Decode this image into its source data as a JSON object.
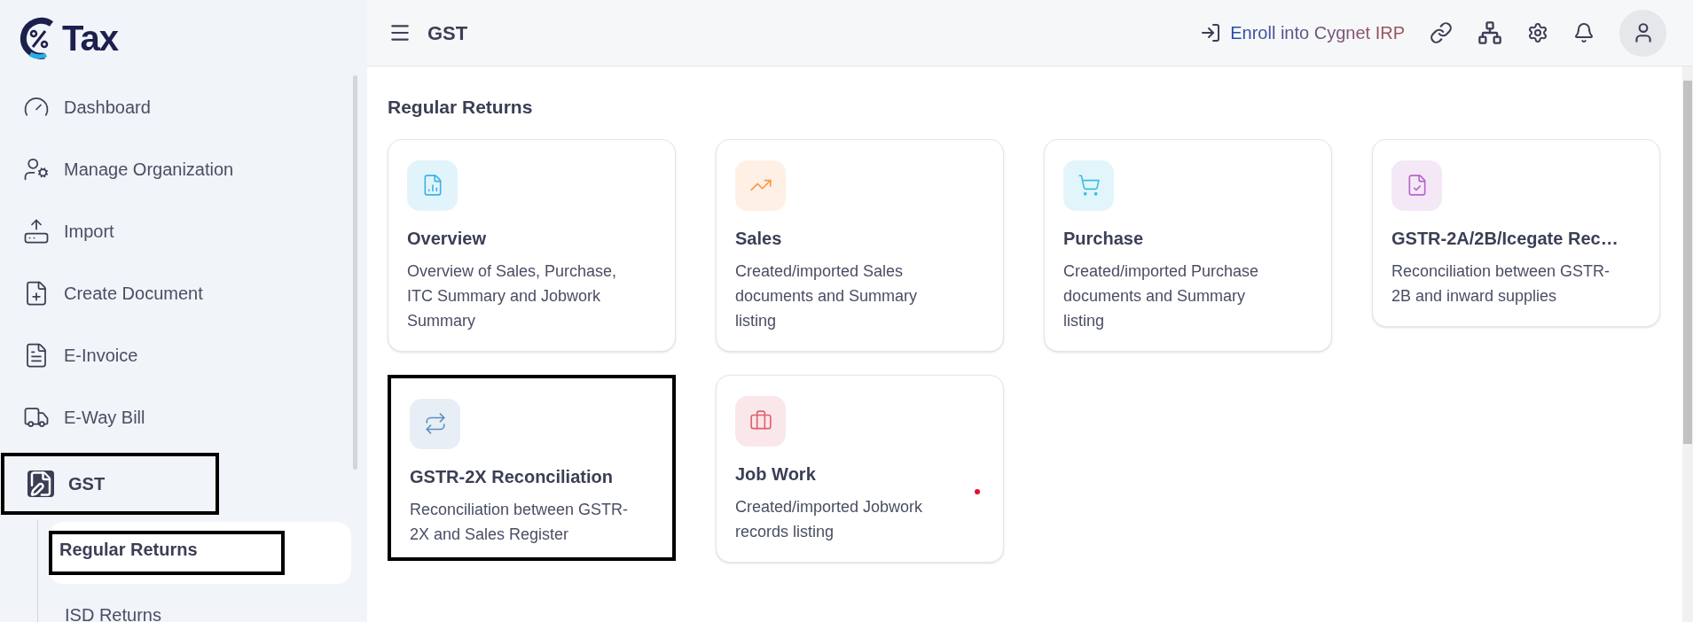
{
  "logo": {
    "text": "Tax"
  },
  "sidebar": {
    "items": [
      {
        "label": "Dashboard",
        "kind": "dashboard",
        "selected": false,
        "highlighted": false
      },
      {
        "label": "Manage Organization",
        "kind": "organization",
        "selected": false,
        "highlighted": false
      },
      {
        "label": "Import",
        "kind": "import",
        "selected": false,
        "highlighted": false
      },
      {
        "label": "Create Document",
        "kind": "create",
        "selected": false,
        "highlighted": false
      },
      {
        "label": "E-Invoice",
        "kind": "invoice",
        "selected": false,
        "highlighted": false
      },
      {
        "label": "E-Way Bill",
        "kind": "truck",
        "selected": false,
        "highlighted": false
      },
      {
        "label": "GST",
        "kind": "gst",
        "selected": true,
        "highlighted": true,
        "expanded": true,
        "children": [
          {
            "label": "Regular Returns",
            "selected": true,
            "highlighted": true
          },
          {
            "label": "ISD Returns",
            "selected": false,
            "highlighted": false
          }
        ]
      }
    ]
  },
  "header": {
    "title": "GST",
    "enroll_link": "Enroll into Cygnet IRP"
  },
  "section_title": "Regular Returns",
  "cards": [
    {
      "title": "Overview",
      "description": "Overview of Sales, Purchase, ITC Summary and Jobwork Summary",
      "kind": "report",
      "color": "#3bb2e6",
      "highlighted": false,
      "notification": false
    },
    {
      "title": "Sales",
      "description": "Created/imported Sales documents and Summary listing",
      "kind": "trend",
      "color": "#f59a4a",
      "highlighted": false,
      "notification": false
    },
    {
      "title": "Purchase",
      "description": "Created/imported Purchase documents and Summary listing",
      "kind": "cart",
      "color": "#3cbfe0",
      "highlighted": false,
      "notification": false
    },
    {
      "title": "GSTR-2A/2B/Icegate Rec…",
      "description": "Reconciliation between GSTR-2B and inward supplies",
      "kind": "check",
      "color": "#b865c9",
      "highlighted": false,
      "notification": false
    },
    {
      "title": "GSTR-2X Reconciliation",
      "description": "Reconciliation between GSTR-2X and Sales Register",
      "kind": "repeat",
      "color": "#5b8fc0",
      "highlighted": true,
      "notification": false
    },
    {
      "title": "Job Work",
      "description": "Created/imported Jobwork records listing",
      "kind": "briefcase",
      "color": "#e0606e",
      "highlighted": false,
      "notification": true
    }
  ]
}
